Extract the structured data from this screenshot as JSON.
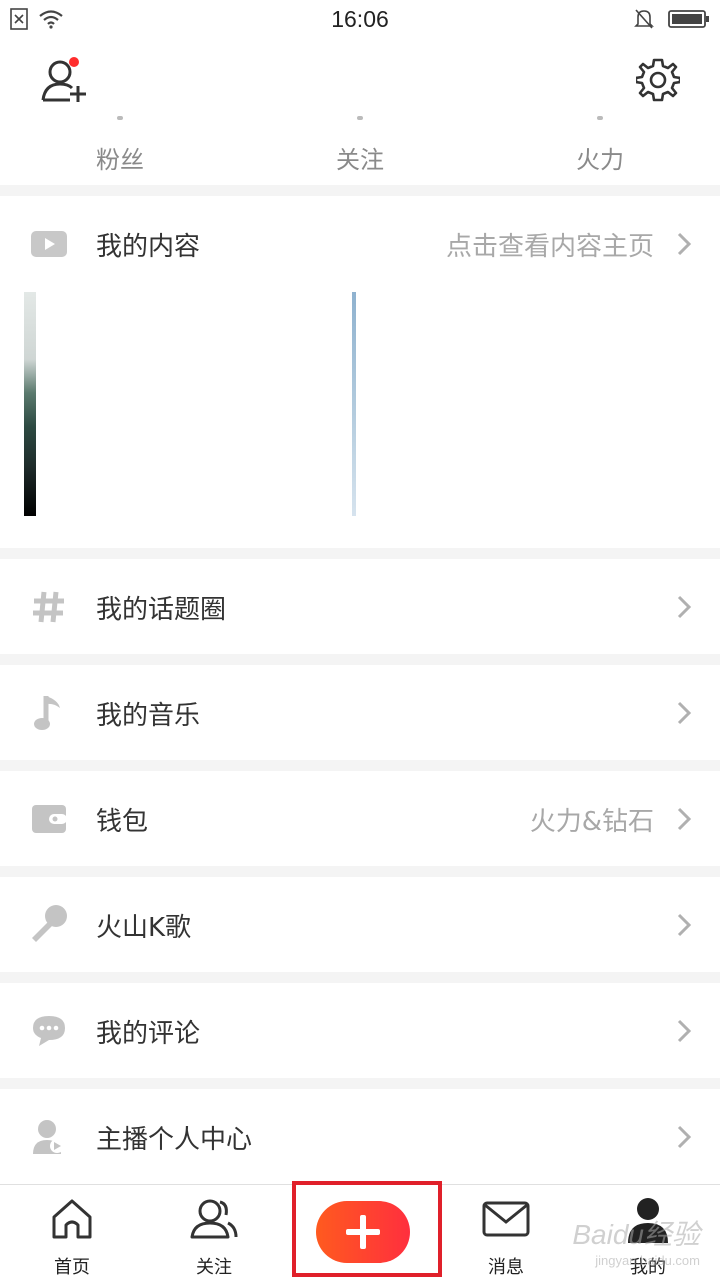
{
  "status_bar": {
    "time": "16:06",
    "icons": [
      "sim-off-icon",
      "wifi-icon",
      "silent-bell-icon",
      "battery-icon"
    ]
  },
  "header": {
    "add_friend_icon": "add-friend-icon",
    "settings_icon": "gear-icon",
    "has_notification_dot": true
  },
  "stats": [
    {
      "label": "粉丝"
    },
    {
      "label": "关注"
    },
    {
      "label": "火力"
    }
  ],
  "content_section": {
    "label": "我的内容",
    "hint": "点击查看内容主页",
    "icon": "video-play-icon"
  },
  "menu": [
    {
      "label": "我的话题圈",
      "icon": "hashtag-icon",
      "hint": ""
    },
    {
      "label": "我的音乐",
      "icon": "music-note-icon",
      "hint": ""
    },
    {
      "label": "钱包",
      "icon": "wallet-icon",
      "hint": "火力&钻石"
    },
    {
      "label": "火山K歌",
      "icon": "microphone-icon",
      "hint": ""
    },
    {
      "label": "我的评论",
      "icon": "comment-icon",
      "hint": ""
    },
    {
      "label": "主播个人中心",
      "icon": "anchor-user-icon",
      "hint": ""
    }
  ],
  "tabbar": {
    "tabs": [
      {
        "label": "首页",
        "icon": "home-icon"
      },
      {
        "label": "关注",
        "icon": "follow-users-icon"
      },
      {
        "label": "",
        "icon": "plus-icon"
      },
      {
        "label": "消息",
        "icon": "mail-icon"
      },
      {
        "label": "我的",
        "icon": "profile-icon"
      }
    ]
  },
  "watermark": {
    "text": "Baidu经验",
    "subtext": "jingyan.baidu.com"
  },
  "colors": {
    "accent_start": "#ff5a1f",
    "accent_end": "#ff2f3e",
    "highlight_box": "#e0202a",
    "notification_dot": "#ff2d2d"
  }
}
